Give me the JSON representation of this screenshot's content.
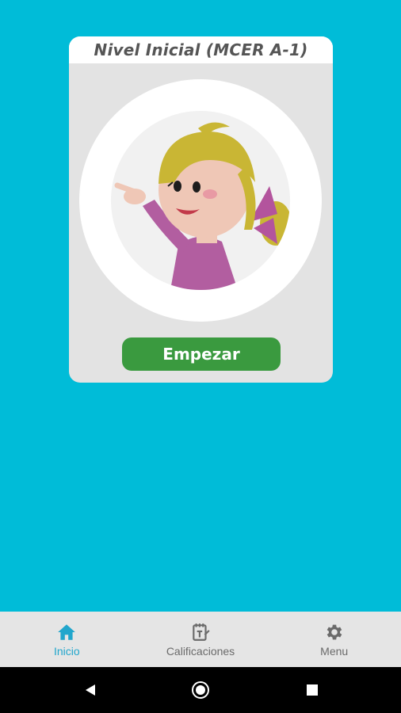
{
  "card": {
    "title": "Nivel Inicial (MCER A-1)",
    "start_label": "Empezar"
  },
  "bottom_nav": {
    "items": [
      {
        "label": "Inicio",
        "icon": "home-icon",
        "active": true
      },
      {
        "label": "Calificaciones",
        "icon": "grades-icon",
        "active": false
      },
      {
        "label": "Menu",
        "icon": "gear-icon",
        "active": false
      }
    ]
  },
  "system_nav": {
    "buttons": [
      "back-icon",
      "home-circle-icon",
      "recents-icon"
    ]
  },
  "colors": {
    "background": "#00bcd8",
    "card": "#e3e3e3",
    "button": "#3a9a3f",
    "nav_active": "#21a6cc",
    "nav_inactive": "#6a6a6a"
  }
}
